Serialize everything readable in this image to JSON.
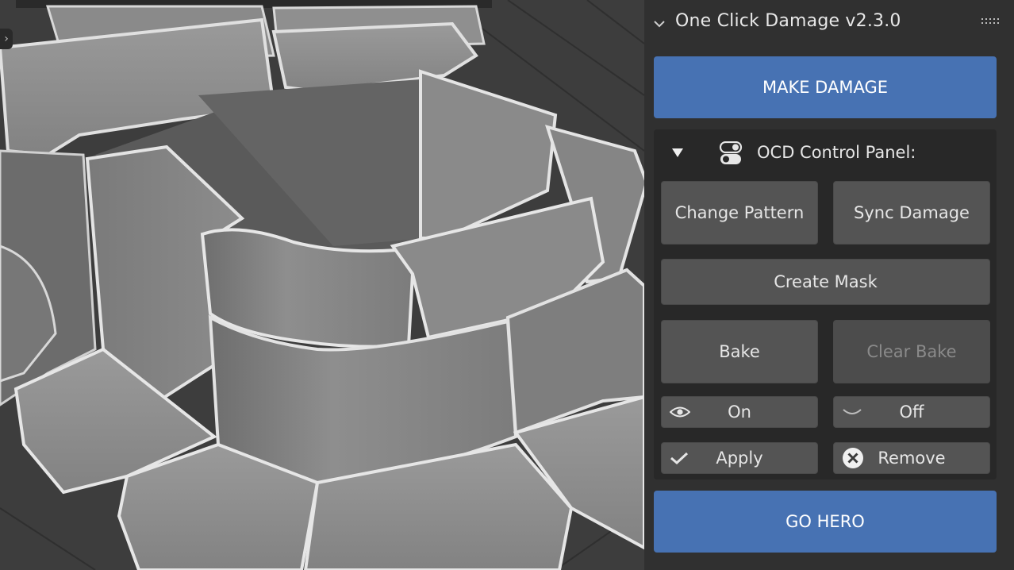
{
  "panel": {
    "title": "One Click Damage v2.3.0",
    "make_damage_label": "MAKE DAMAGE",
    "go_hero_label": "GO HERO",
    "control_panel": {
      "title": "OCD Control Panel:",
      "change_pattern_label": "Change Pattern",
      "sync_damage_label": "Sync Damage",
      "create_mask_label": "Create Mask",
      "bake_label": "Bake",
      "clear_bake_label": "Clear Bake",
      "on_label": "On",
      "off_label": "Off",
      "apply_label": "Apply",
      "remove_label": "Remove"
    }
  },
  "colors": {
    "accent_button": "#4772b3",
    "panel_bg": "#303030",
    "subpanel_bg": "#282828",
    "button_bg": "#545454"
  },
  "icons": {
    "header": "chevron-down-icon",
    "drag": "drag-handle-icon",
    "subpanel": "toggle-control-icon",
    "on": "eye-icon",
    "off": "eye-closed-icon",
    "apply": "checkmark-icon",
    "remove": "x-circle-icon"
  }
}
